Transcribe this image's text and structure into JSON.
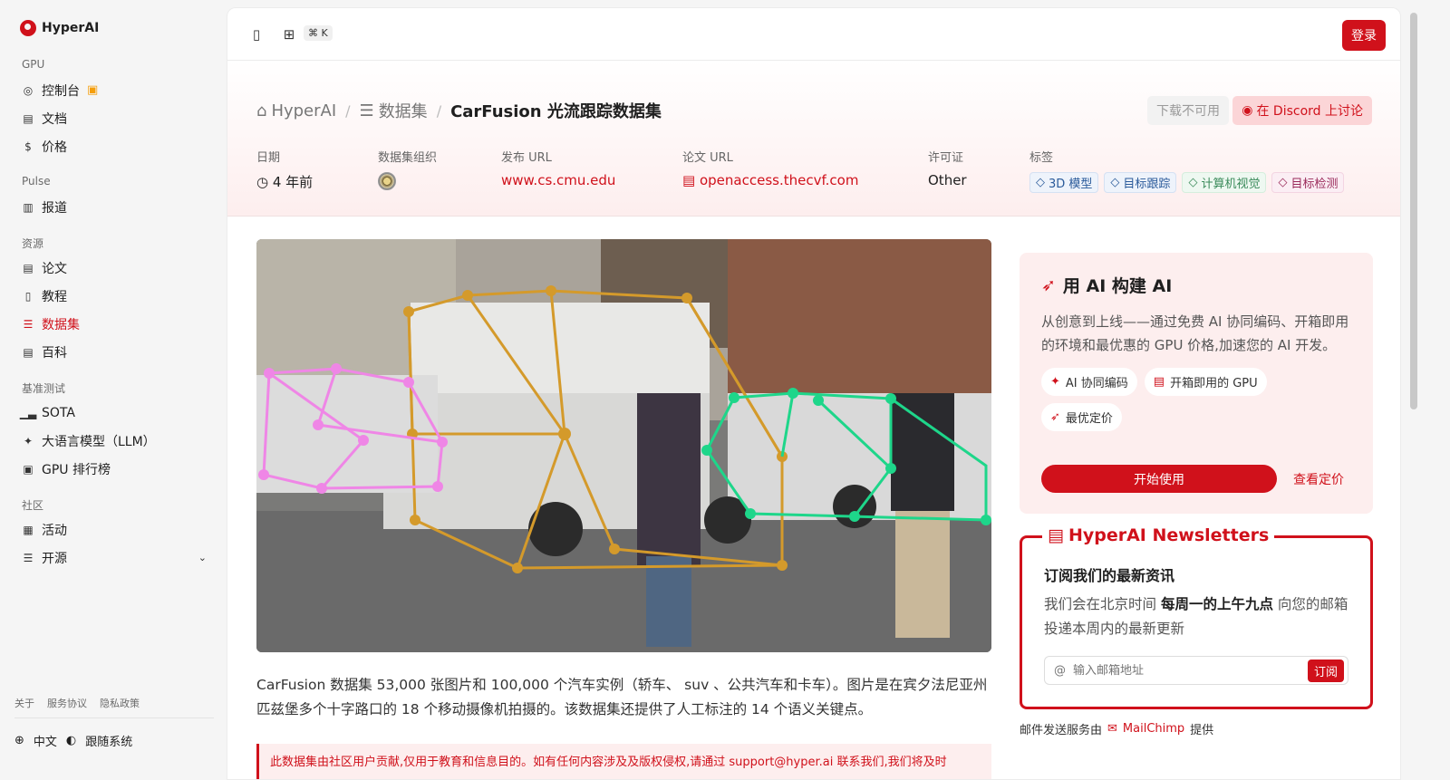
{
  "brand": {
    "name": "HyperAI"
  },
  "sidebar": {
    "sections": [
      {
        "title": "GPU",
        "items": [
          {
            "label": "控制台",
            "icon": "gauge-icon",
            "badge_icon": "gift-icon"
          },
          {
            "label": "文档",
            "icon": "book-icon"
          },
          {
            "label": "价格",
            "icon": "dollar-icon"
          }
        ]
      },
      {
        "title": "Pulse",
        "items": [
          {
            "label": "报道",
            "icon": "newspaper-icon"
          }
        ]
      },
      {
        "title": "资源",
        "items": [
          {
            "label": "论文",
            "icon": "paper-icon"
          },
          {
            "label": "教程",
            "icon": "notebook-icon"
          },
          {
            "label": "数据集",
            "icon": "database-icon",
            "active": true
          },
          {
            "label": "百科",
            "icon": "encyclopedia-icon"
          }
        ]
      },
      {
        "title": "基准测试",
        "items": [
          {
            "label": "SOTA",
            "icon": "bar-chart-icon"
          },
          {
            "label": "大语言模型（LLM）",
            "icon": "sparkles-icon"
          },
          {
            "label": "GPU 排行榜",
            "icon": "chip-icon"
          }
        ]
      },
      {
        "title": "社区",
        "items": [
          {
            "label": "活动",
            "icon": "calendar-icon"
          },
          {
            "label": "开源",
            "icon": "list-icon"
          }
        ]
      }
    ],
    "footer_links": [
      "关于",
      "服务协议",
      "隐私政策"
    ],
    "language": "中文",
    "theme": "跟随系统"
  },
  "topbar": {
    "shortcut": "⌘ K",
    "login_label": "登录"
  },
  "breadcrumb": {
    "home": "HyperAI",
    "section": "数据集",
    "current": "CarFusion 光流跟踪数据集"
  },
  "header_buttons": {
    "download": "下载不可用",
    "discord": "在 Discord 上讨论"
  },
  "meta": {
    "date_label": "日期",
    "date_value": "4 年前",
    "org_label": "数据集组织",
    "publish_label": "发布 URL",
    "publish_value": "www.cs.cmu.edu",
    "paper_label": "论文 URL",
    "paper_value": "openaccess.thecvf.com",
    "license_label": "许可证",
    "license_value": "Other",
    "tags_label": "标签",
    "tags": [
      "3D 模型",
      "目标跟踪",
      "计算机视觉",
      "目标检测"
    ]
  },
  "description": "CarFusion 数据集 53,000 张图片和 100,000 个汽车实例（轿车、 suv 、公共汽车和卡车）。图片是在宾夕法尼亚州匹兹堡多个十字路口的 18 个移动摄像机拍摄的。该数据集还提供了人工标注的 14 个语义关键点。",
  "notice": "此数据集由社区用户贡献,仅用于教育和信息目的。如有任何内容涉及及版权侵权,请通过 support@hyper.ai 联系我们,我们将及时",
  "promo": {
    "title": "用 AI 构建 AI",
    "desc": "从创意到上线——通过免费 AI 协同编码、开箱即用的环境和最优惠的 GPU 价格,加速您的 AI 开发。",
    "chips": [
      "AI 协同编码",
      "开箱即用的 GPU",
      "最优定价"
    ],
    "cta": "开始使用",
    "pricing_link": "查看定价"
  },
  "newsletter": {
    "title": "HyperAI Newsletters",
    "heading": "订阅我们的最新资讯",
    "p_before": "我们会在北京时间 ",
    "p_bold": "每周一的上午九点",
    "p_after": " 向您的邮箱投递本周内的最新更新",
    "placeholder": "输入邮箱地址",
    "subscribe": "订阅"
  },
  "mail_credit": {
    "before": "邮件发送服务由",
    "brand": "MailChimp",
    "after": "提供"
  }
}
